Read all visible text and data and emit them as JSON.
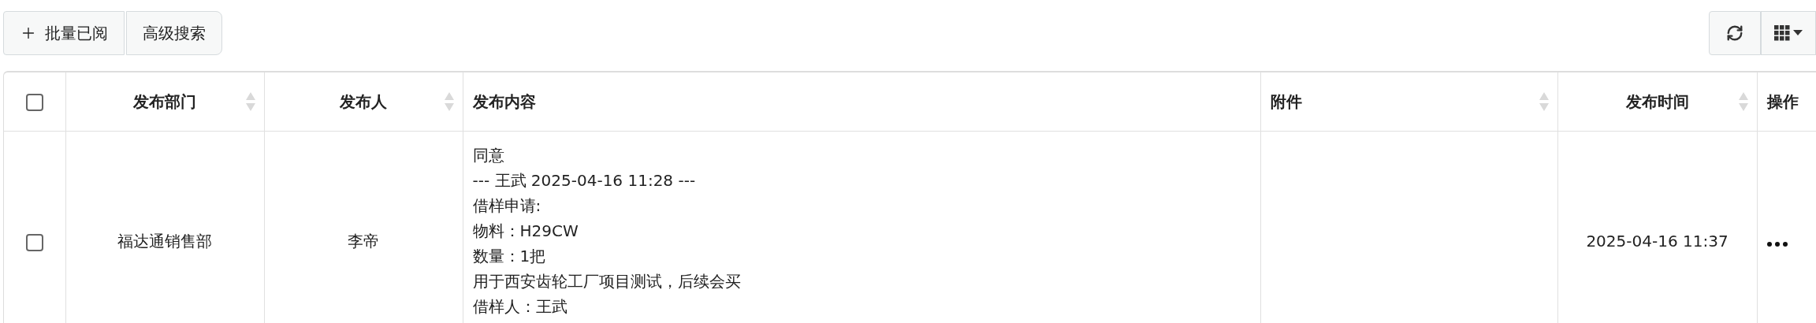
{
  "toolbar": {
    "buttons": [
      {
        "label": "批量已阅",
        "kind": "add"
      },
      {
        "label": "高级搜索",
        "kind": "plain"
      }
    ],
    "tools": [
      {
        "kind": "refresh"
      },
      {
        "kind": "columns"
      }
    ]
  },
  "table": {
    "select_all": {
      "checked": false
    },
    "columns": [
      {
        "label": "发布部门",
        "sortable": true
      },
      {
        "label": "发布人",
        "sortable": true
      },
      {
        "label": "发布内容",
        "sortable": false
      },
      {
        "label": "附件",
        "sortable": true
      },
      {
        "label": "发布时间",
        "sortable": true
      },
      {
        "label": "操作",
        "sortable": false
      }
    ],
    "rows": [
      {
        "checked": false,
        "cells": [
          "福达通销售部",
          "李帝",
          [
            "同意",
            "--- 王武 2025-04-16 11:28 ---",
            "借样申请:",
            "物料：H29CW",
            "数量：1把",
            "用于西安齿轮工厂项目测试，后续会买",
            "借样人：王武"
          ],
          "",
          "2025-04-16 11:37"
        ],
        "actions": {
          "kind": "more"
        }
      }
    ]
  }
}
